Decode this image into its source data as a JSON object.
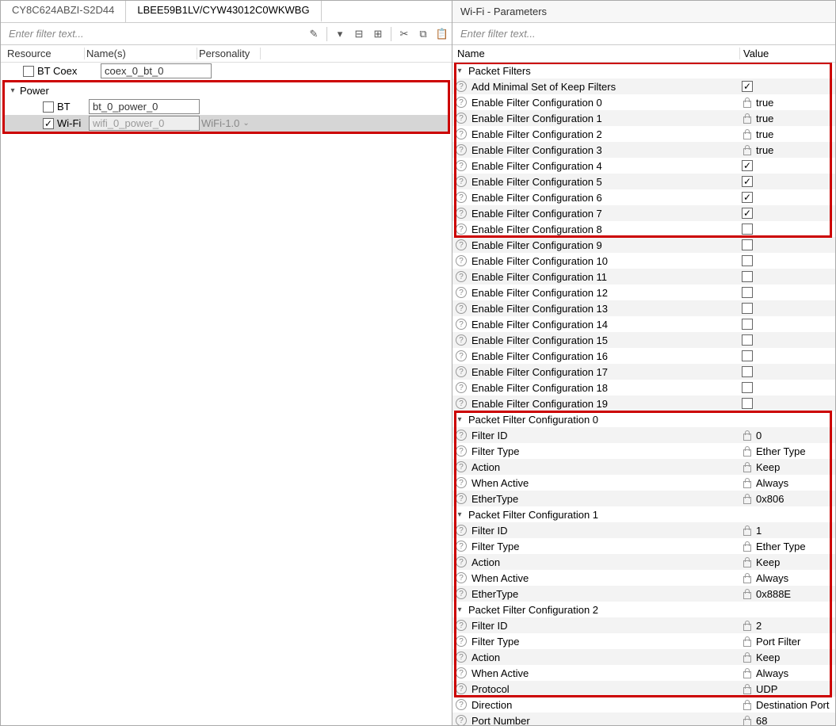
{
  "tabs": {
    "inactive": "CY8C624ABZI-S2D44",
    "active": "LBEE59B1LV/CYW43012C0WKWBG"
  },
  "left": {
    "filter_placeholder": "Enter filter text...",
    "headers": {
      "c1": "Resource",
      "c2": "Name(s)",
      "c3": "Personality"
    },
    "btcoex": {
      "label": "BT Coex",
      "name": "coex_0_bt_0"
    },
    "power": {
      "label": "Power"
    },
    "bt": {
      "label": "BT",
      "name": "bt_0_power_0"
    },
    "wifi": {
      "label": "Wi-Fi",
      "name": "wifi_0_power_0",
      "personality": "WiFi-1.0"
    }
  },
  "right": {
    "title": "Wi-Fi - Parameters",
    "filter_placeholder": "Enter filter text...",
    "headers": {
      "name": "Name",
      "value": "Value"
    },
    "packetFilters": {
      "label": "Packet Filters",
      "addMinimal": "Add Minimal Set of Keep Filters",
      "enable": [
        {
          "label": "Enable Filter Configuration 0",
          "locked": true,
          "val": "true"
        },
        {
          "label": "Enable Filter Configuration 1",
          "locked": true,
          "val": "true"
        },
        {
          "label": "Enable Filter Configuration 2",
          "locked": true,
          "val": "true"
        },
        {
          "label": "Enable Filter Configuration 3",
          "locked": true,
          "val": "true"
        },
        {
          "label": "Enable Filter Configuration 4",
          "checked": true
        },
        {
          "label": "Enable Filter Configuration 5",
          "checked": true
        },
        {
          "label": "Enable Filter Configuration 6",
          "checked": true
        },
        {
          "label": "Enable Filter Configuration 7",
          "checked": true
        },
        {
          "label": "Enable Filter Configuration 8",
          "checked": false
        },
        {
          "label": "Enable Filter Configuration 9",
          "checked": false
        },
        {
          "label": "Enable Filter Configuration 10",
          "checked": false
        },
        {
          "label": "Enable Filter Configuration 11",
          "checked": false
        },
        {
          "label": "Enable Filter Configuration 12",
          "checked": false
        },
        {
          "label": "Enable Filter Configuration 13",
          "checked": false
        },
        {
          "label": "Enable Filter Configuration 14",
          "checked": false
        },
        {
          "label": "Enable Filter Configuration 15",
          "checked": false
        },
        {
          "label": "Enable Filter Configuration 16",
          "checked": false
        },
        {
          "label": "Enable Filter Configuration 17",
          "checked": false
        },
        {
          "label": "Enable Filter Configuration 18",
          "checked": false
        },
        {
          "label": "Enable Filter Configuration 19",
          "checked": false
        }
      ]
    },
    "configs": [
      {
        "label": "Packet Filter Configuration 0",
        "rows": [
          {
            "name": "Filter ID",
            "val": "0"
          },
          {
            "name": "Filter Type",
            "val": "Ether Type"
          },
          {
            "name": "Action",
            "val": "Keep"
          },
          {
            "name": "When Active",
            "val": "Always"
          },
          {
            "name": "EtherType",
            "val": "0x806"
          }
        ]
      },
      {
        "label": "Packet Filter Configuration 1",
        "rows": [
          {
            "name": "Filter ID",
            "val": "1"
          },
          {
            "name": "Filter Type",
            "val": "Ether Type"
          },
          {
            "name": "Action",
            "val": "Keep"
          },
          {
            "name": "When Active",
            "val": "Always"
          },
          {
            "name": "EtherType",
            "val": "0x888E"
          }
        ]
      },
      {
        "label": "Packet Filter Configuration 2",
        "rows": [
          {
            "name": "Filter ID",
            "val": "2"
          },
          {
            "name": "Filter Type",
            "val": "Port Filter"
          },
          {
            "name": "Action",
            "val": "Keep"
          },
          {
            "name": "When Active",
            "val": "Always"
          },
          {
            "name": "Protocol",
            "val": "UDP"
          },
          {
            "name": "Direction",
            "val": "Destination Port"
          },
          {
            "name": "Port Number",
            "val": "68"
          }
        ]
      }
    ]
  }
}
